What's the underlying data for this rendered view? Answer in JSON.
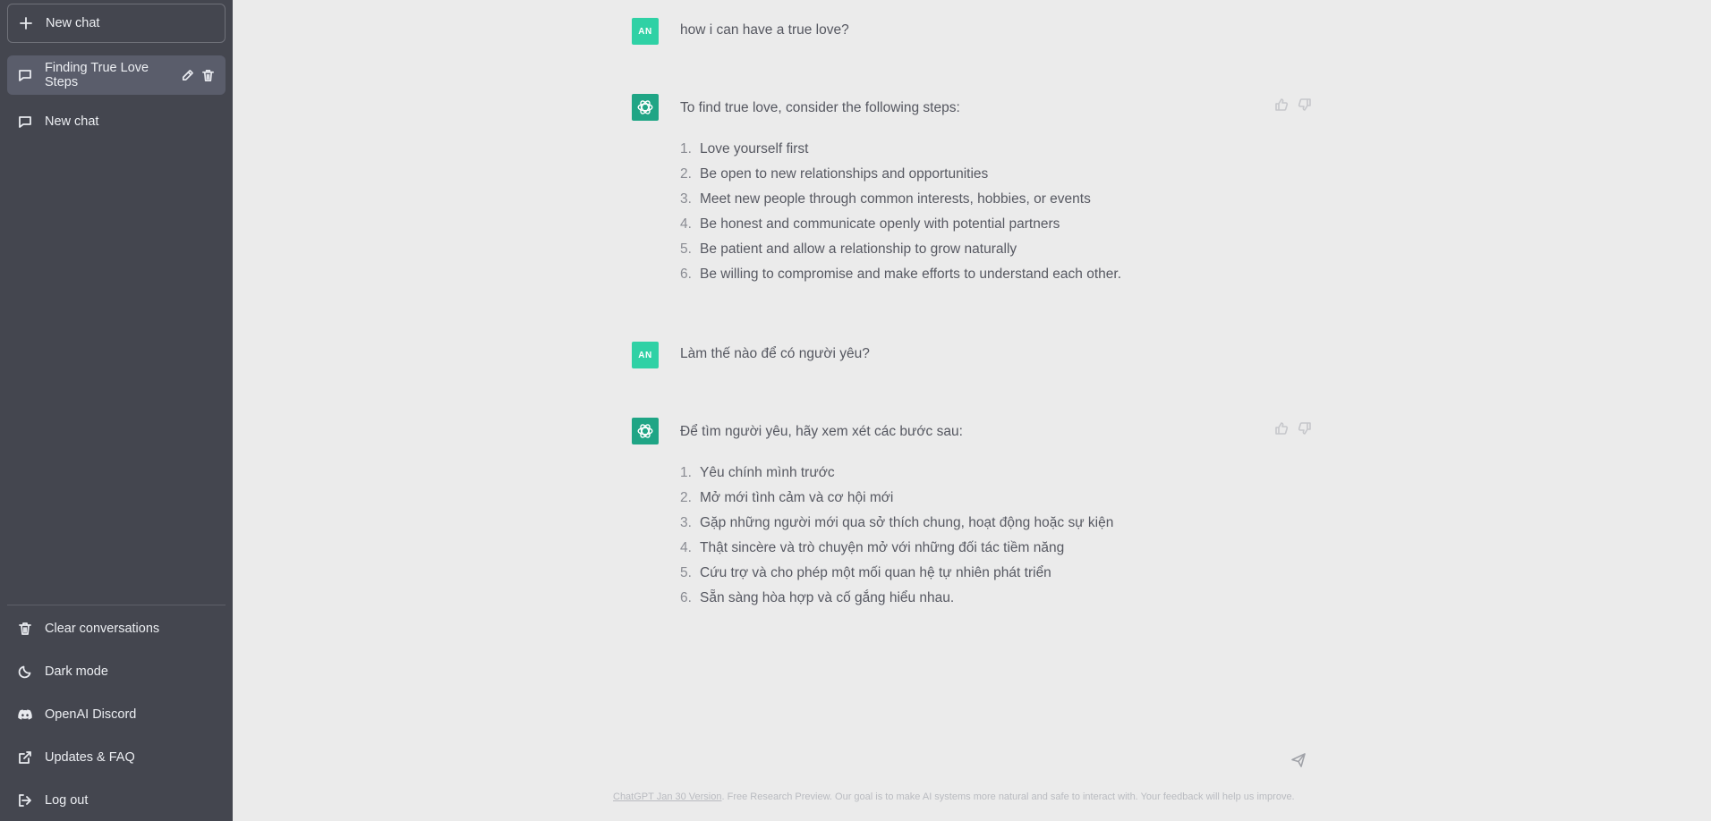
{
  "sidebar": {
    "new_chat_label": "New chat",
    "conversations": [
      {
        "title": "Finding True Love Steps",
        "active": true
      },
      {
        "title": "New chat",
        "active": false
      }
    ],
    "bottom": [
      {
        "label": "Clear conversations",
        "icon": "trash-icon"
      },
      {
        "label": "Dark mode",
        "icon": "moon-icon"
      },
      {
        "label": "OpenAI Discord",
        "icon": "discord-icon"
      },
      {
        "label": "Updates & FAQ",
        "icon": "external-link-icon"
      },
      {
        "label": "Log out",
        "icon": "logout-icon"
      }
    ]
  },
  "messages": [
    {
      "role": "user",
      "avatar": "AN",
      "text": "how i can have a true love?"
    },
    {
      "role": "assistant",
      "text": "To find true love, consider the following steps:",
      "list": [
        "Love yourself first",
        "Be open to new relationships and opportunities",
        "Meet new people through common interests, hobbies, or events",
        "Be honest and communicate openly with potential partners",
        "Be patient and allow a relationship to grow naturally",
        "Be willing to compromise and make efforts to understand each other."
      ]
    },
    {
      "role": "user",
      "avatar": "AN",
      "text": "Làm thế nào để có người yêu?"
    },
    {
      "role": "assistant",
      "text": "Để tìm người yêu, hãy xem xét các bước sau:",
      "list": [
        "Yêu chính mình trước",
        "Mở mới tình cảm và cơ hội mới",
        "Gặp những người mới qua sở thích chung, hoạt động hoặc sự kiện",
        "Thật sincère và trò chuyện mở với những đối tác tiềm năng",
        "Cứu trợ và cho phép một mối quan hệ tự nhiên phát triển",
        "Sẵn sàng hòa hợp và cố gắng hiểu nhau."
      ]
    }
  ],
  "list_numbers": [
    "1.",
    "2.",
    "3.",
    "4.",
    "5.",
    "6."
  ],
  "footer": {
    "version_link": "ChatGPT Jan 30 Version",
    "text": ". Free Research Preview. Our goal is to make AI systems more natural and safe to interact with. Your feedback will help us improve."
  },
  "colors": {
    "sidebar_bg": "#44464f",
    "main_bg": "#ebebeb",
    "user_avatar": "#2fd1a5",
    "bot_avatar": "#1fa585",
    "active_conversation": "#5a5d6b"
  }
}
